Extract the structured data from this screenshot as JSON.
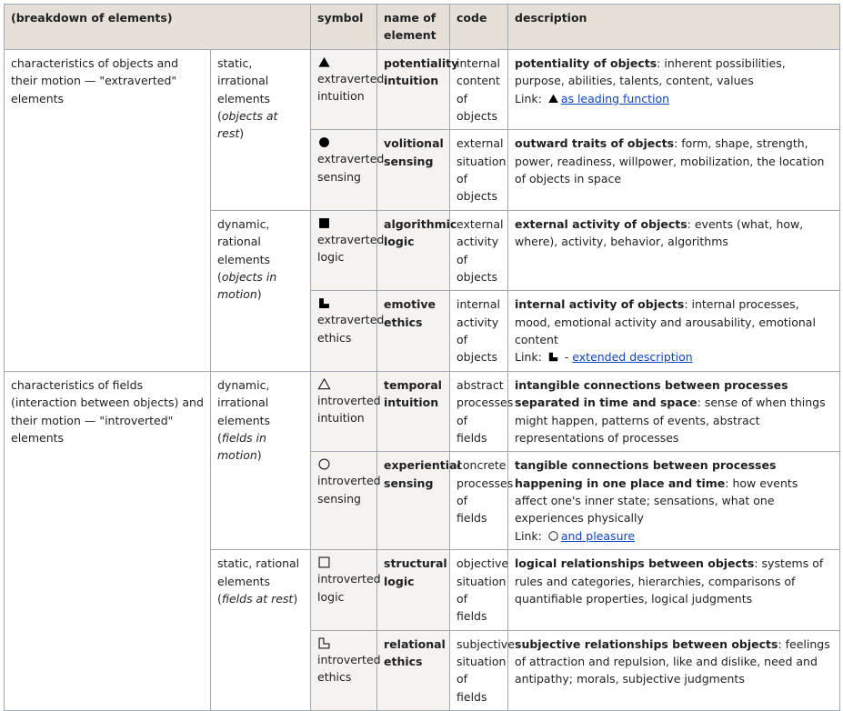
{
  "table": {
    "headers": {
      "breakdown": "(breakdown of elements)",
      "symbol": "symbol",
      "name": "name of element",
      "code": "code",
      "description": "description"
    },
    "groups": [
      {
        "label": "characteristics of objects and their motion — \"extraverted\" elements",
        "subgroups": [
          {
            "label_plain": "static, irrational elements (",
            "label_italic": "objects at rest",
            "label_tail": ")",
            "rows": [
              {
                "symbol_icon": "filled-triangle-icon",
                "symbol_label_line1": "extraverted",
                "symbol_label_line2": "intuition",
                "name": "potentiality intuition",
                "code": "internal content of objects",
                "desc_bold": "potentiality of objects",
                "desc_rest": ": inherent possibilities, purpose, abilities, talents, content, values",
                "link_prefix": "Link:",
                "link_icon": "filled-triangle-icon",
                "link_dash": "",
                "link_text": "as leading function"
              },
              {
                "symbol_icon": "filled-circle-icon",
                "symbol_label_line1": "extraverted",
                "symbol_label_line2": "sensing",
                "name": "volitional sensing",
                "code": "external situation of objects",
                "desc_bold": "outward traits of objects",
                "desc_rest": ": form, shape, strength, power, readiness, willpower, mobilization, the location of objects in space",
                "link_prefix": "",
                "link_icon": "",
                "link_dash": "",
                "link_text": ""
              }
            ]
          },
          {
            "label_plain": "dynamic, rational elements (",
            "label_italic": "objects in motion",
            "label_tail": ")",
            "rows": [
              {
                "symbol_icon": "filled-square-icon",
                "symbol_label_line1": "extraverted",
                "symbol_label_line2": "logic",
                "name": "algorithmic logic",
                "code": "external activity of objects",
                "desc_bold": "external activity of objects",
                "desc_rest": ": events (what, how, where), activity, behavior, algorithms",
                "link_prefix": "",
                "link_icon": "",
                "link_dash": "",
                "link_text": ""
              },
              {
                "symbol_icon": "filled-corner-icon",
                "symbol_label_line1": "extraverted",
                "symbol_label_line2": "ethics",
                "name": "emotive ethics",
                "code": "internal activity of objects",
                "desc_bold": "internal activity of objects",
                "desc_rest": ": internal processes, mood, emotional activity and arousability, emotional content",
                "link_prefix": "Link:",
                "link_icon": "filled-corner-icon",
                "link_dash": "-",
                "link_text": "extended description"
              }
            ]
          }
        ]
      },
      {
        "label": "characteristics of fields (interaction between objects) and their motion — \"introverted\" elements",
        "subgroups": [
          {
            "label_plain": "dynamic, irrational elements (",
            "label_italic": "fields in motion",
            "label_tail": ")",
            "rows": [
              {
                "symbol_icon": "hollow-triangle-icon",
                "symbol_label_line1": "introverted",
                "symbol_label_line2": "intuition",
                "name": "temporal intuition",
                "code": "abstract processes of fields",
                "desc_bold": "intangible connections between processes separated in time and space",
                "desc_rest": ": sense of when things might happen, patterns of events, abstract representations of processes",
                "link_prefix": "",
                "link_icon": "",
                "link_dash": "",
                "link_text": ""
              },
              {
                "symbol_icon": "hollow-circle-icon",
                "symbol_label_line1": "introverted",
                "symbol_label_line2": "sensing",
                "name": "experiential sensing",
                "code": "concrete processes of fields",
                "desc_bold": "tangible connections between processes happening in one place and time",
                "desc_rest": ": how events affect one's inner state; sensations, what one experiences physically",
                "link_prefix": "Link:",
                "link_icon": "hollow-circle-icon",
                "link_dash": "",
                "link_text": "and pleasure"
              }
            ]
          },
          {
            "label_plain": "static, rational elements (",
            "label_italic": "fields at rest",
            "label_tail": ")",
            "rows": [
              {
                "symbol_icon": "hollow-square-icon",
                "symbol_label_line1": "introverted",
                "symbol_label_line2": "logic",
                "name": "structural logic",
                "code": "objective situation of fields",
                "desc_bold": "logical relationships between objects",
                "desc_rest": ": systems of rules and categories, hierarchies, comparisons of quantifiable properties, logical judgments",
                "link_prefix": "",
                "link_icon": "",
                "link_dash": "",
                "link_text": ""
              },
              {
                "symbol_icon": "hollow-corner-icon",
                "symbol_label_line1": "introverted",
                "symbol_label_line2": "ethics",
                "name": "relational ethics",
                "code": "subjective situation of fields",
                "desc_bold": "subjective relationships between objects",
                "desc_rest": ": feelings of attraction and repulsion, like and dislike, need and antipathy; morals, subjective judgments",
                "link_prefix": "",
                "link_icon": "",
                "link_dash": "",
                "link_text": ""
              }
            ]
          }
        ]
      }
    ]
  },
  "colors": {
    "header_bg": "#e7e0d8",
    "symbol_bg": "#f5f2f0",
    "border": "#a2a9b1",
    "link": "#0b45c4",
    "text": "#202122"
  }
}
